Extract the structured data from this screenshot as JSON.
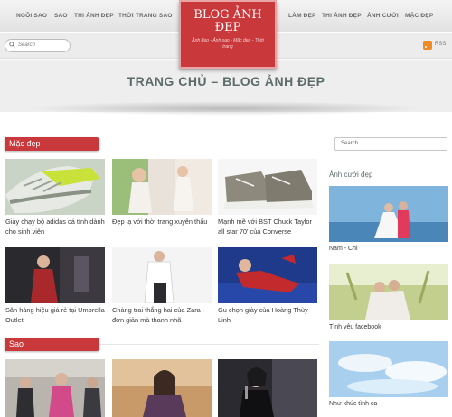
{
  "nav": {
    "left": [
      "NGÔI SAO",
      "SAO",
      "THI ẢNH ĐẸP",
      "THỜI TRANG SAO"
    ],
    "right": [
      "LÀM ĐẸP",
      "THI ẢNH ĐẸP",
      "ẢNH CƯỚI",
      "MẶC ĐẸP"
    ]
  },
  "logo": {
    "title": "BLOG ẢNH ĐẸP",
    "tagline": "Ảnh đẹp - Ảnh sao - Mặc đẹp - Thời trang"
  },
  "search": {
    "placeholder": "Search"
  },
  "rss": {
    "label": "RSS"
  },
  "page_title": "TRANG CHỦ – BLOG ẢNH ĐẸP",
  "sections": [
    {
      "label": "Mặc đẹp",
      "posts": [
        {
          "caption": "Giày chạy bộ adidas cá tính dành cho sinh viên"
        },
        {
          "caption": "Đẹp lạ với thời trang xuyên thấu"
        },
        {
          "caption": "Mạnh mẽ với BST Chuck Taylor all star 70' của Converse"
        },
        {
          "caption": "Săn hàng hiệu giá rẻ tại Umbrella Outlet"
        },
        {
          "caption": "Chàng trai thắng hai của Zara - đơn giản mà thanh nhã"
        },
        {
          "caption": "Gu chọn giày của Hoàng Thùy Linh"
        }
      ]
    },
    {
      "label": "Sao"
    }
  ],
  "sidebar": {
    "search_placeholder": "Search",
    "title": "Ảnh cưới đẹp",
    "items": [
      {
        "caption": "Nam - Chi"
      },
      {
        "caption": "Tình yêu facebook"
      },
      {
        "caption": "Như khúc tình ca"
      }
    ]
  },
  "colors": {
    "accent": "#c9383a",
    "title": "#5d6b6b"
  }
}
